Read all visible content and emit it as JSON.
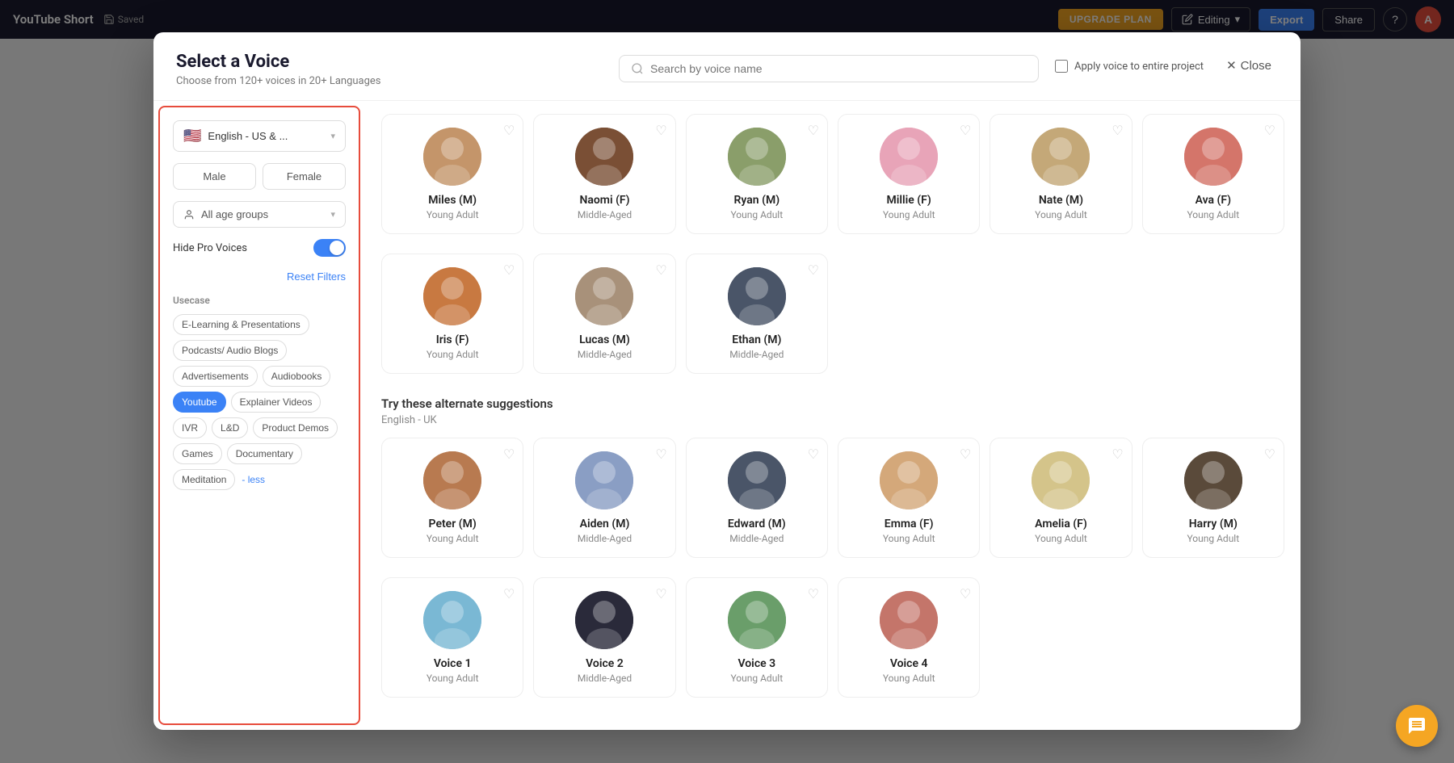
{
  "appBar": {
    "title": "YouTube Short",
    "savedLabel": "Saved",
    "upgradePlan": "UPGRADE PLAN",
    "editing": "Editing",
    "export": "Export",
    "share": "Share",
    "help": "?",
    "avatarInitial": "A"
  },
  "modal": {
    "title": "Select a Voice",
    "subtitle": "Choose from 120+ voices in 20+ Languages",
    "searchPlaceholder": "Search by voice name",
    "applyVoiceLabel": "Apply voice to entire project",
    "closeLabel": "Close"
  },
  "sidebar": {
    "languageLabel": "English - US & ...",
    "genderMale": "Male",
    "genderFemale": "Female",
    "ageGroupLabel": "All age groups",
    "hideProVoices": "Hide Pro Voices",
    "resetFilters": "Reset Filters",
    "usecaseLabel": "Usecase",
    "tags": [
      {
        "label": "E-Learning & Presentations",
        "active": false
      },
      {
        "label": "Podcasts/ Audio Blogs",
        "active": false
      },
      {
        "label": "Advertisements",
        "active": false
      },
      {
        "label": "Audiobooks",
        "active": false
      },
      {
        "label": "Youtube",
        "active": true
      },
      {
        "label": "Explainer Videos",
        "active": false
      },
      {
        "label": "IVR",
        "active": false
      },
      {
        "label": "L&D",
        "active": false
      },
      {
        "label": "Product Demos",
        "active": false
      },
      {
        "label": "Games",
        "active": false
      },
      {
        "label": "Documentary",
        "active": false
      },
      {
        "label": "Meditation",
        "active": false
      }
    ],
    "lessLabel": "- less"
  },
  "mainVoices": [
    {
      "name": "Miles (M)",
      "age": "Young Adult",
      "color": "#c4956a"
    },
    {
      "name": "Naomi (F)",
      "age": "Middle-Aged",
      "color": "#7a4f35"
    },
    {
      "name": "Ryan (M)",
      "age": "Young Adult",
      "color": "#8a9e6a"
    },
    {
      "name": "Millie (F)",
      "age": "Young Adult",
      "color": "#e8a4b8"
    },
    {
      "name": "Nate (M)",
      "age": "Young Adult",
      "color": "#c4a878"
    },
    {
      "name": "Ava (F)",
      "age": "Young Adult",
      "color": "#d4756a"
    }
  ],
  "row2Voices": [
    {
      "name": "Iris (F)",
      "age": "Young Adult",
      "color": "#c87941"
    },
    {
      "name": "Lucas (M)",
      "age": "Middle-Aged",
      "color": "#a8917a"
    },
    {
      "name": "Ethan (M)",
      "age": "Middle-Aged",
      "color": "#4a5568"
    }
  ],
  "altSuggestions": {
    "title": "Try these alternate suggestions",
    "subtitle": "English - UK"
  },
  "altVoices": [
    {
      "name": "Peter (M)",
      "age": "Young Adult",
      "color": "#b87a50"
    },
    {
      "name": "Aiden (M)",
      "age": "Middle-Aged",
      "color": "#8a9ec4"
    },
    {
      "name": "Edward (M)",
      "age": "Middle-Aged",
      "color": "#4a5568"
    },
    {
      "name": "Emma (F)",
      "age": "Young Adult",
      "color": "#d4a87a"
    },
    {
      "name": "Amelia (F)",
      "age": "Young Adult",
      "color": "#d4c48a"
    },
    {
      "name": "Harry (M)",
      "age": "Young Adult",
      "color": "#5a4a3a"
    }
  ],
  "row3Voices": [
    {
      "name": "Voice 1",
      "age": "Young Adult",
      "color": "#7ab8d4"
    },
    {
      "name": "Voice 2",
      "age": "Middle-Aged",
      "color": "#2a2a3a"
    },
    {
      "name": "Voice 3",
      "age": "Young Adult",
      "color": "#6a9e6a"
    },
    {
      "name": "Voice 4",
      "age": "Young Adult",
      "color": "#c4756a"
    }
  ]
}
